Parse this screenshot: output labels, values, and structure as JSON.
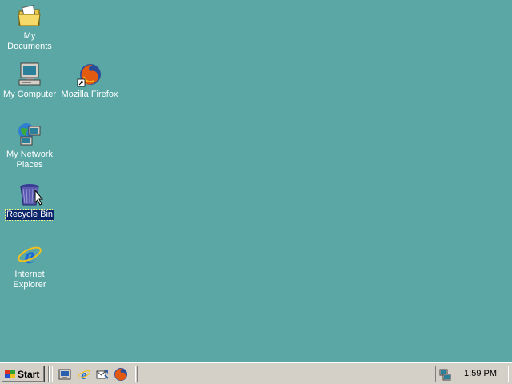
{
  "desktop": {
    "background_color": "#5aa7a5",
    "icons": [
      {
        "label": "My Documents",
        "icon": "folder-documents-icon"
      },
      {
        "label": "My Computer",
        "icon": "computer-icon"
      },
      {
        "label": "Mozilla Firefox",
        "icon": "firefox-icon"
      },
      {
        "label": "My Network Places",
        "icon": "network-places-icon"
      },
      {
        "label": "Recycle Bin",
        "icon": "recycle-bin-icon",
        "selected": true
      },
      {
        "label": "Internet Explorer",
        "icon": "internet-explorer-icon"
      }
    ]
  },
  "taskbar": {
    "start_label": "Start",
    "quick_launch": [
      "show-desktop-icon",
      "internet-explorer-icon",
      "outlook-express-icon",
      "firefox-icon"
    ],
    "clock": "1:59 PM"
  }
}
